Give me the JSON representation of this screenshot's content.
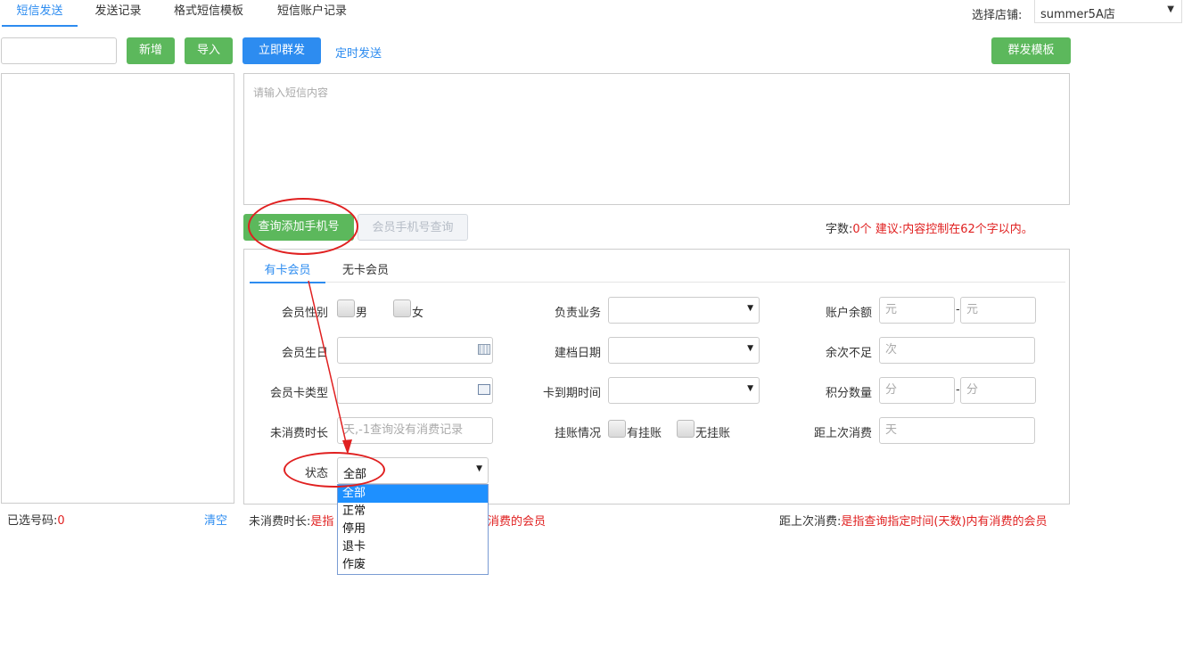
{
  "tabs": [
    "短信发送",
    "发送记录",
    "格式短信模板",
    "短信账户记录"
  ],
  "store": {
    "label": "选择店铺:",
    "value": "summer5A店"
  },
  "toolbar": {
    "add": "新增",
    "import": "导入",
    "send_now": "立即群发",
    "scheduled": "定时发送",
    "template": "群发模板"
  },
  "message": {
    "placeholder": "请输入短信内容"
  },
  "query": {
    "add_phone": "查询添加手机号",
    "member_phone_query": "会员手机号查询",
    "word_count_label": "字数:",
    "word_count_value": "0个",
    "suggestion": "建议:内容控制在62个字以内。"
  },
  "member_tabs": [
    "有卡会员",
    "无卡会员"
  ],
  "form": {
    "gender": "会员性别",
    "male": "男",
    "female": "女",
    "business": "负责业务",
    "balance": "账户余额",
    "yuan": "元",
    "dash": "-",
    "birthday": "会员生日",
    "filing_date": "建档日期",
    "remaining": "余次不足",
    "times": "次",
    "card_type": "会员卡类型",
    "expire": "卡到期时间",
    "points": "积分数量",
    "fen": "分",
    "no_consume": "未消费时长",
    "no_consume_ph": "天,-1查询没有消费记录",
    "credit": "挂账情况",
    "has_credit": "有挂账",
    "no_credit": "无挂账",
    "last_consume": "距上次消费",
    "day": "天",
    "status": "状态",
    "status_value": "全部"
  },
  "status_options": [
    "全部",
    "正常",
    "停用",
    "退卡",
    "作废"
  ],
  "footer": {
    "selected_label": "已选号码:",
    "selected_count": "0",
    "clear": "清空",
    "note1_label": "未消费时长:",
    "note1_a": "是指",
    "note1_b": "消费的会员",
    "note2_label": "距上次消费:",
    "note2_text": "是指查询指定时间(天数)内有消费的会员"
  },
  "colors": {
    "green": "#5cb85c",
    "blue": "#2d8cf0",
    "red": "#e02020"
  }
}
